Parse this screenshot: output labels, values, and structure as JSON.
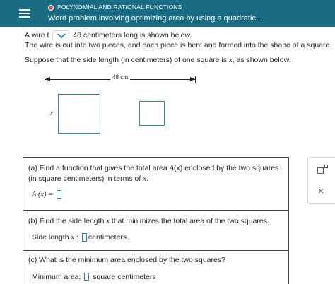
{
  "header": {
    "topic": "POLYNOMIAL AND RATIONAL FUNCTIONS",
    "title": "Word problem involving optimizing area by using a quadratic..."
  },
  "problem": {
    "line1_start": "A wire",
    "line1_cut": "t",
    "line1_end": "48 centimeters long is shown below.",
    "line2": "The wire is cut into two pieces, and each piece is bent and formed into the shape of a square.",
    "suppose_start": "Suppose that the side length (in centimeters) of one square is",
    "suppose_var": "x",
    "suppose_end": ", as shown below."
  },
  "figure": {
    "length_label": "48 cm",
    "side_label": "x"
  },
  "questions": {
    "a": {
      "text_start": "(a) Find a function that gives the total area",
      "func": "A",
      "arg": "(x)",
      "text_end": "enclosed by the two squares (in square centimeters) in terms of",
      "var": "x",
      "period": ".",
      "answer_label": "A (x) ="
    },
    "b": {
      "text_start": "(b) Find the side length",
      "var": "x",
      "text_end": "that minimizes the total area of the two squares.",
      "answer_label": "Side length",
      "answer_var": "x",
      "answer_colon": ":",
      "unit": "centimeters"
    },
    "c": {
      "text": "(c) What is the minimum area enclosed by the two squares?",
      "answer_label": "Minimum area:",
      "unit": "square centimeters"
    }
  },
  "side_panel": {
    "tool_icon": "superscript-template-icon",
    "close_icon": "close-icon",
    "close_glyph": "×"
  },
  "colors": {
    "header_bg": "#1a6c85",
    "accent": "#2a86b6",
    "status_dot": "#d9534f"
  }
}
